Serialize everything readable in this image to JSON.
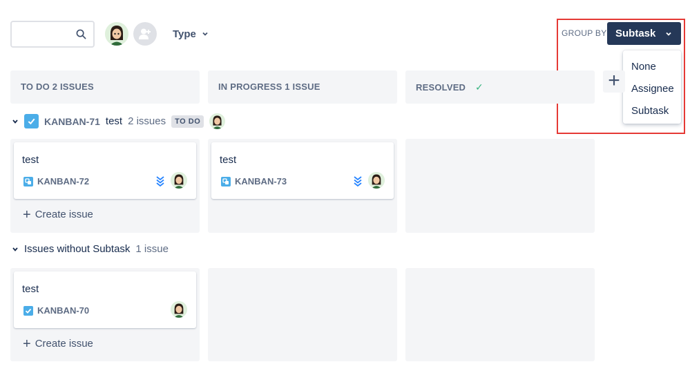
{
  "toolbar": {
    "search_placeholder": "",
    "type_label": "Type",
    "group_by_label": "GROUP BY",
    "group_by_value": "Subtask"
  },
  "group_options": [
    "None",
    "Assignee",
    "Subtask"
  ],
  "columns": [
    {
      "title": "TO DO 2 ISSUES"
    },
    {
      "title": "IN PROGRESS 1 ISSUE"
    },
    {
      "title": "RESOLVED"
    }
  ],
  "swimlanes": [
    {
      "key": "KANBAN-71",
      "summary": "test",
      "count": "2 issues",
      "status": "TO DO",
      "cards": [
        {
          "summary": "test",
          "key": "KANBAN-72",
          "type": "subtask-icon",
          "priority": "lowest-priority-icon"
        },
        {
          "summary": "test",
          "key": "KANBAN-73",
          "type": "subtask-icon",
          "priority": "lowest-priority-icon"
        }
      ],
      "create_label": "Create issue"
    },
    {
      "title": "Issues without Subtask",
      "count": "1 issue",
      "cards": [
        {
          "summary": "test",
          "key": "KANBAN-70",
          "type": "task-icon"
        }
      ],
      "create_label": "Create issue"
    }
  ],
  "colors": {
    "accent": "#253858",
    "lane_background": "#f4f5f7",
    "resolved_check": "#36b37e",
    "highlight": "#e53935",
    "task_icon": "#4bade8"
  }
}
